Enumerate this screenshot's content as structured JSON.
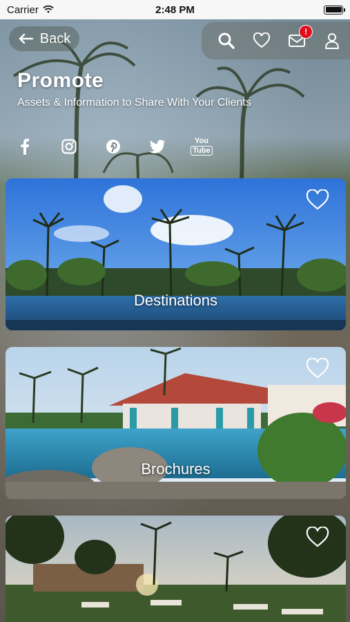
{
  "status_bar": {
    "carrier": "Carrier",
    "time": "2:48 PM"
  },
  "nav": {
    "back_label": "Back",
    "notification_badge": "!"
  },
  "header": {
    "title": "Promote",
    "subtitle": "Assets & Information to Share With Your Clients"
  },
  "social": {
    "youtube_text_top": "You",
    "youtube_text_bottom": "Tube",
    "icons": [
      "facebook-icon",
      "instagram-icon",
      "pinterest-icon",
      "twitter-icon",
      "youtube-icon"
    ]
  },
  "cards": [
    {
      "label": "Destinations"
    },
    {
      "label": "Brochures"
    },
    {
      "label": ""
    }
  ],
  "colors": {
    "badge": "#e20d1b",
    "statusbar_bg": "#f7f7f7"
  }
}
